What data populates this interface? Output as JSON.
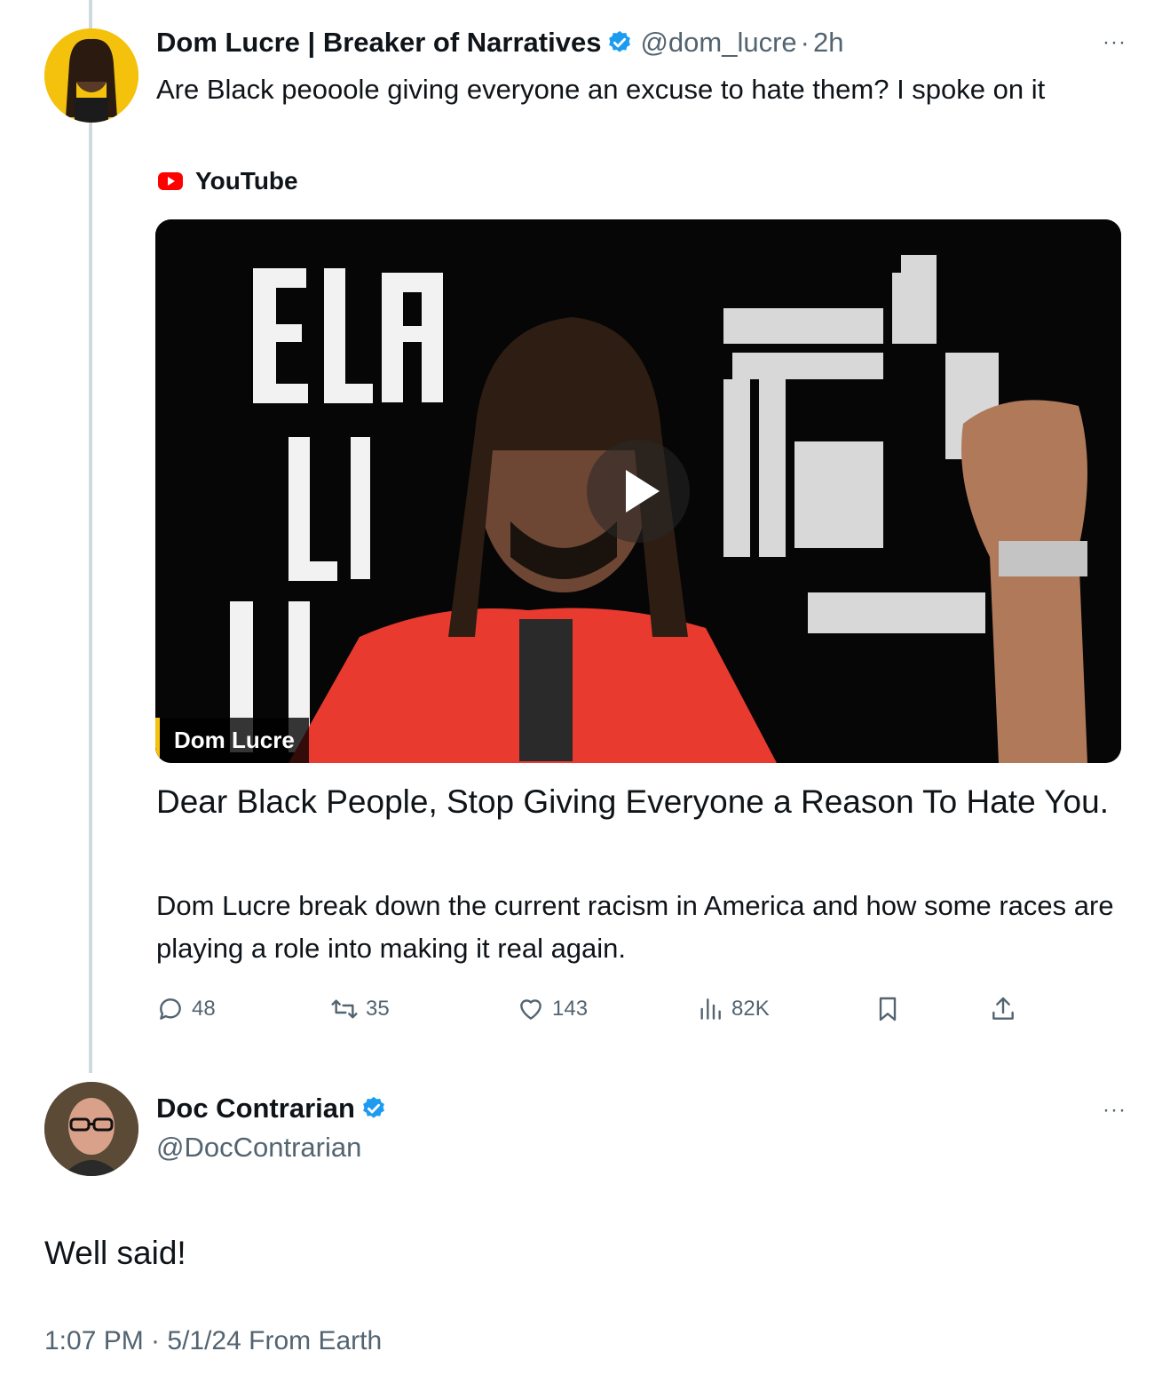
{
  "tweet1": {
    "author_name": "Dom Lucre | Breaker of Narratives",
    "handle": "@dom_lucre",
    "separator": "·",
    "time": "2h",
    "text": "Are Black peooole giving everyone an excuse to hate them? I spoke on it",
    "more_label": "···",
    "link_source": "YouTube",
    "media_label": "Dom Lucre",
    "card_title": "Dear Black People, Stop Giving Everyone a Reason To Hate You.",
    "card_description": "Dom Lucre break down the current racism in America and how some races are playing a role into making it real again.",
    "stats": {
      "replies": "48",
      "reposts": "35",
      "likes": "143",
      "views": "82K"
    }
  },
  "tweet2": {
    "author_name": "Doc Contrarian",
    "handle": "@DocContrarian",
    "more_label": "···",
    "text": "Well said!",
    "footer": "1:07 PM · 5/1/24 From Earth"
  },
  "colors": {
    "verified": "#1d9bf0",
    "muted": "#536471",
    "thread_line": "#cfd9de",
    "youtube_red": "#ff0000"
  },
  "icons": {
    "reply": "speech-bubble-icon",
    "repost": "repost-arrows-icon",
    "like": "heart-icon",
    "views": "bar-chart-icon",
    "bookmark": "bookmark-icon",
    "share": "share-upload-icon"
  }
}
